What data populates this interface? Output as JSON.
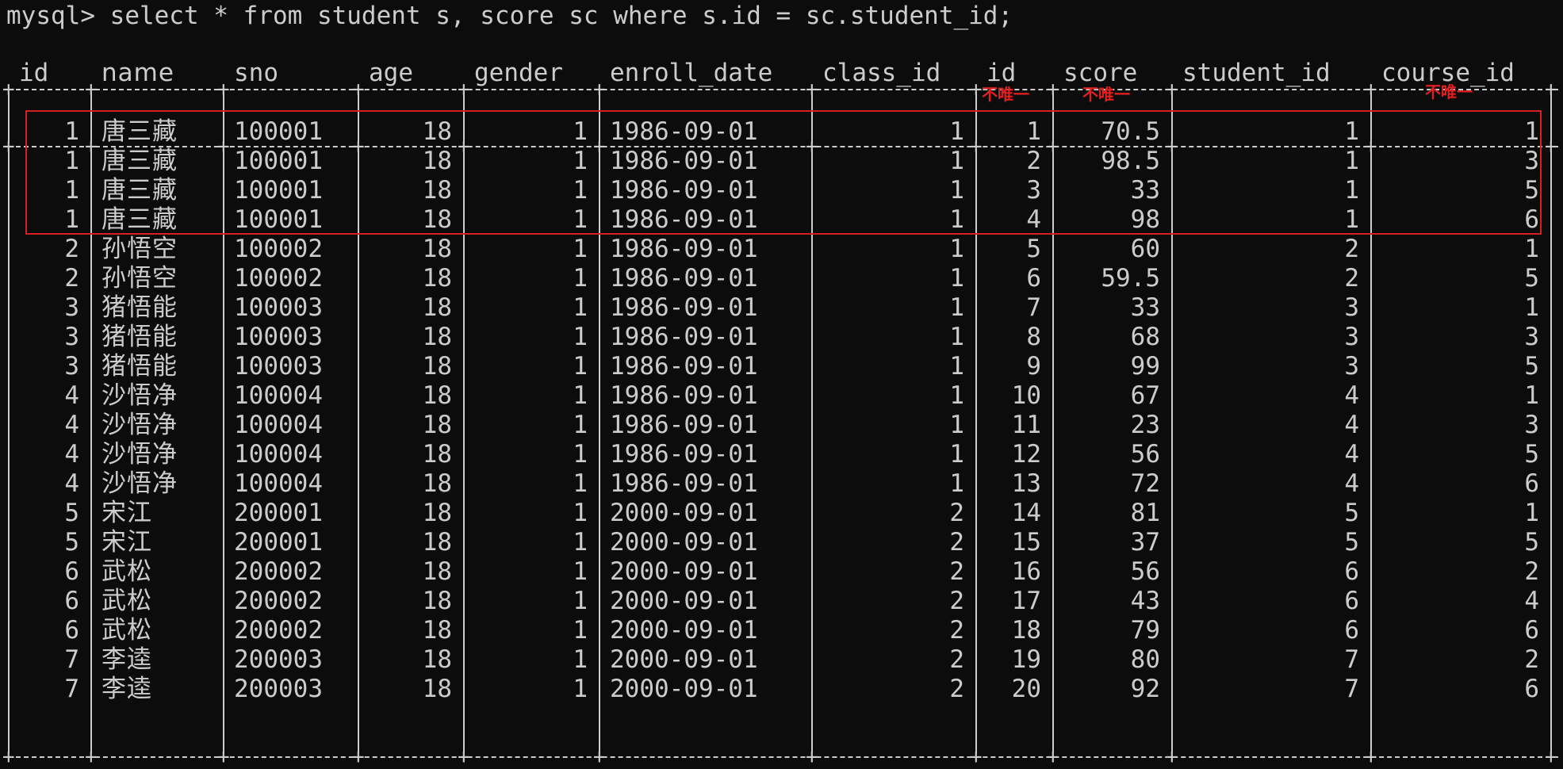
{
  "terminal": {
    "prompt": "mysql> ",
    "command": "select * from student s, score sc where s.id = sc.student_id;"
  },
  "table": {
    "columns": [
      "id",
      "name",
      "sno",
      "age",
      "gender",
      "enroll_date",
      "class_id",
      "id",
      "score",
      "student_id",
      "course_id"
    ],
    "rows": [
      [
        "1",
        "唐三藏",
        "100001",
        "18",
        "1",
        "1986-09-01",
        "1",
        "1",
        "70.5",
        "1",
        "1"
      ],
      [
        "1",
        "唐三藏",
        "100001",
        "18",
        "1",
        "1986-09-01",
        "1",
        "2",
        "98.5",
        "1",
        "3"
      ],
      [
        "1",
        "唐三藏",
        "100001",
        "18",
        "1",
        "1986-09-01",
        "1",
        "3",
        "33",
        "1",
        "5"
      ],
      [
        "1",
        "唐三藏",
        "100001",
        "18",
        "1",
        "1986-09-01",
        "1",
        "4",
        "98",
        "1",
        "6"
      ],
      [
        "2",
        "孙悟空",
        "100002",
        "18",
        "1",
        "1986-09-01",
        "1",
        "5",
        "60",
        "2",
        "1"
      ],
      [
        "2",
        "孙悟空",
        "100002",
        "18",
        "1",
        "1986-09-01",
        "1",
        "6",
        "59.5",
        "2",
        "5"
      ],
      [
        "3",
        "猪悟能",
        "100003",
        "18",
        "1",
        "1986-09-01",
        "1",
        "7",
        "33",
        "3",
        "1"
      ],
      [
        "3",
        "猪悟能",
        "100003",
        "18",
        "1",
        "1986-09-01",
        "1",
        "8",
        "68",
        "3",
        "3"
      ],
      [
        "3",
        "猪悟能",
        "100003",
        "18",
        "1",
        "1986-09-01",
        "1",
        "9",
        "99",
        "3",
        "5"
      ],
      [
        "4",
        "沙悟净",
        "100004",
        "18",
        "1",
        "1986-09-01",
        "1",
        "10",
        "67",
        "4",
        "1"
      ],
      [
        "4",
        "沙悟净",
        "100004",
        "18",
        "1",
        "1986-09-01",
        "1",
        "11",
        "23",
        "4",
        "3"
      ],
      [
        "4",
        "沙悟净",
        "100004",
        "18",
        "1",
        "1986-09-01",
        "1",
        "12",
        "56",
        "4",
        "5"
      ],
      [
        "4",
        "沙悟净",
        "100004",
        "18",
        "1",
        "1986-09-01",
        "1",
        "13",
        "72",
        "4",
        "6"
      ],
      [
        "5",
        "宋江",
        "200001",
        "18",
        "1",
        "2000-09-01",
        "2",
        "14",
        "81",
        "5",
        "1"
      ],
      [
        "5",
        "宋江",
        "200001",
        "18",
        "1",
        "2000-09-01",
        "2",
        "15",
        "37",
        "5",
        "5"
      ],
      [
        "6",
        "武松",
        "200002",
        "18",
        "1",
        "2000-09-01",
        "2",
        "16",
        "56",
        "6",
        "2"
      ],
      [
        "6",
        "武松",
        "200002",
        "18",
        "1",
        "2000-09-01",
        "2",
        "17",
        "43",
        "6",
        "4"
      ],
      [
        "6",
        "武松",
        "200002",
        "18",
        "1",
        "2000-09-01",
        "2",
        "18",
        "79",
        "6",
        "6"
      ],
      [
        "7",
        "李逵",
        "200003",
        "18",
        "1",
        "2000-09-01",
        "2",
        "19",
        "80",
        "7",
        "2"
      ],
      [
        "7",
        "李逵",
        "200003",
        "18",
        "1",
        "2000-09-01",
        "2",
        "20",
        "92",
        "7",
        "6"
      ]
    ]
  },
  "annotations": {
    "sc_id_note": "不唯一",
    "score_note": "不唯一",
    "course_id_note": "不唯一"
  },
  "colors": {
    "background": "#0c0c0c",
    "text": "#cccccc",
    "annotation": "#e02020"
  }
}
